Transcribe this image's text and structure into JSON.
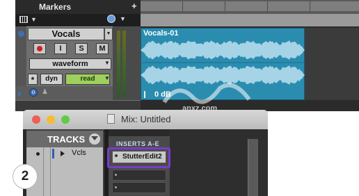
{
  "edit_window": {
    "markers_label": "Markers",
    "markers_add": "+",
    "track": {
      "name": "Vocals",
      "buttons": {
        "record": "",
        "input": "I",
        "solo": "S",
        "mute": "M"
      },
      "view": "waveform",
      "insert_star": "*",
      "playlist_button": "dyn",
      "automation_mode": "read",
      "o_label": "o"
    },
    "region": {
      "name": "Vocals-01",
      "gain": "0 dB"
    }
  },
  "mix_window": {
    "title": "Mix: Untitled",
    "traffic_lights": {
      "close": "#ee5e56",
      "minimize": "#f5bd2f",
      "zoom": "#5fcc44"
    },
    "tracks_header": "TRACKS",
    "track_rows": [
      {
        "name": "Vcls"
      }
    ],
    "inserts_label": "INSERTS A-E",
    "inserts": [
      {
        "name": "StutterEdit2"
      }
    ]
  },
  "step_badge": "2",
  "colors": {
    "highlight": "#7a3cc8",
    "waveform_bg": "#2a8db0",
    "waveform": "#a6d3e6",
    "automation_read": "#9fcf5f",
    "track_blue": "#3f6fb2"
  },
  "icons": {
    "markers_add": "plus-icon",
    "track_grid": "grid-icon",
    "timebase": "clock-icon",
    "tracks_menu": "menu-icon",
    "window_doc": "document-icon",
    "region_gain": "gain-icon"
  }
}
